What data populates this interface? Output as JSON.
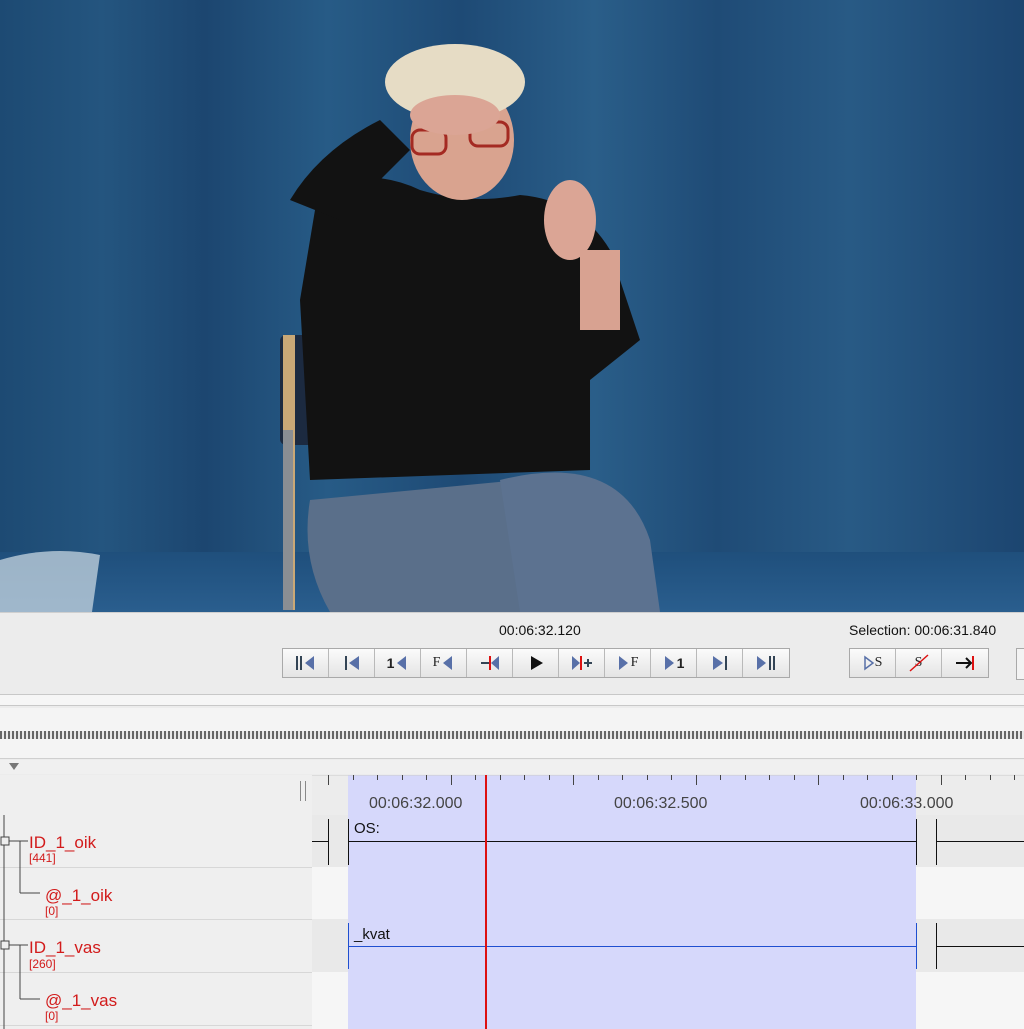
{
  "player": {
    "current_time": "00:06:32.120",
    "selection_label": "Selection: 00:06:31.840"
  },
  "buttons": [
    {
      "icon": "go-to-begin-icon"
    },
    {
      "icon": "previous-scroll-view-icon"
    },
    {
      "icon": "previous-second-icon",
      "label": "1"
    },
    {
      "icon": "previous-frame-icon",
      "label": "F"
    },
    {
      "icon": "previous-pixel-icon"
    },
    {
      "icon": "play-icon"
    },
    {
      "icon": "next-pixel-icon"
    },
    {
      "icon": "next-frame-icon",
      "label": "F"
    },
    {
      "icon": "next-second-icon",
      "label": "1"
    },
    {
      "icon": "next-scroll-view-icon"
    },
    {
      "icon": "go-to-end-icon"
    }
  ],
  "selection_buttons": [
    {
      "icon": "play-selection-icon",
      "label": "S"
    },
    {
      "icon": "clear-selection-icon",
      "label": "S"
    },
    {
      "icon": "selection-mode-icon"
    }
  ],
  "ruler": {
    "labels": [
      "00:06:32.000",
      "00:06:32.500",
      "00:06:33.000"
    ]
  },
  "tiers": [
    {
      "name": "ID_1_oik",
      "count": "[441]"
    },
    {
      "name": "@_1_oik",
      "count": "[0]"
    },
    {
      "name": "ID_1_vas",
      "count": "[260]"
    },
    {
      "name": "@_1_vas",
      "count": "[0]"
    }
  ],
  "annotations": [
    {
      "tier": "ID_1_oik",
      "value": "OS:"
    },
    {
      "tier": "ID_1_vas",
      "value": "_kvat"
    }
  ],
  "colors": {
    "tier_name": "#d21b1b",
    "selection": "#d6d8fb",
    "crosshair": "#d11111",
    "active_annotation": "#1f4fd0"
  }
}
